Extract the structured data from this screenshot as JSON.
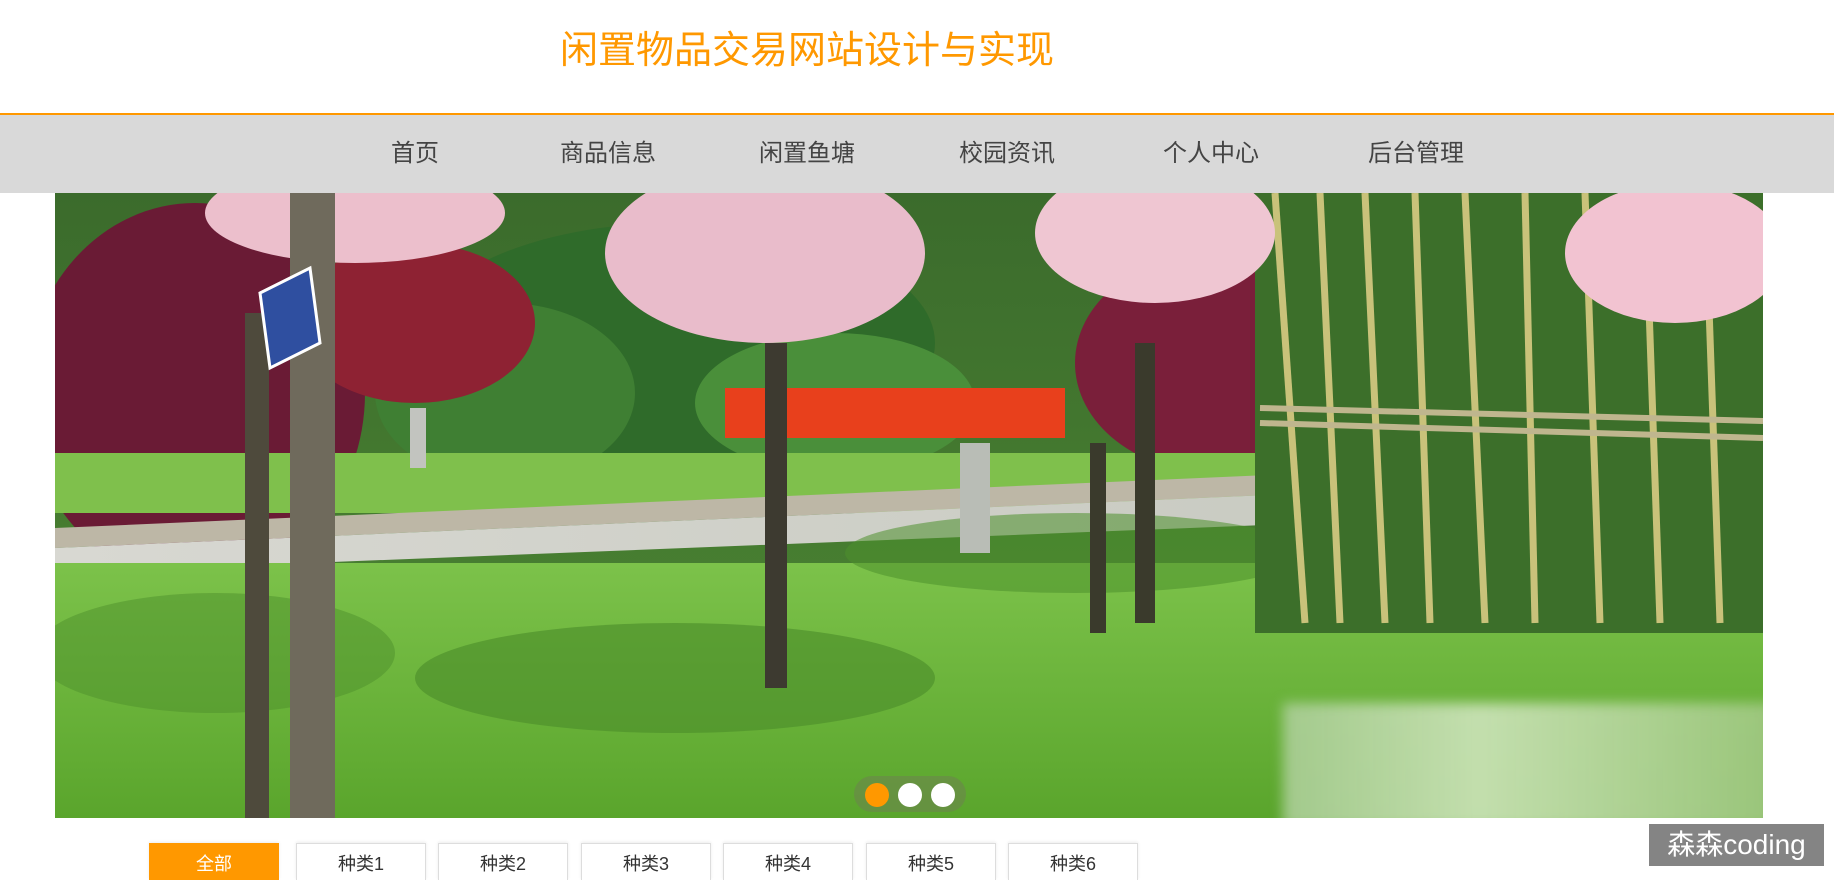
{
  "site": {
    "title": "闲置物品交易网站设计与实现"
  },
  "nav": {
    "items": [
      {
        "label": "首页",
        "active": true
      },
      {
        "label": "商品信息",
        "active": false
      },
      {
        "label": "闲置鱼塘",
        "active": false
      },
      {
        "label": "校园资讯",
        "active": false
      },
      {
        "label": "个人中心",
        "active": false
      },
      {
        "label": "后台管理",
        "active": false
      }
    ]
  },
  "banner": {
    "slide_count": 3,
    "current_slide": 1
  },
  "categories": {
    "items": [
      {
        "label": "全部",
        "active": true
      },
      {
        "label": "种类1",
        "active": false
      },
      {
        "label": "种类2",
        "active": false
      },
      {
        "label": "种类3",
        "active": false
      },
      {
        "label": "种类4",
        "active": false
      },
      {
        "label": "种类5",
        "active": false
      },
      {
        "label": "种类6",
        "active": false
      }
    ]
  },
  "watermark": {
    "text": "森森coding"
  },
  "colors": {
    "accent": "#ff9800",
    "nav_background": "#d9d9d9",
    "nav_text": "#444444"
  }
}
